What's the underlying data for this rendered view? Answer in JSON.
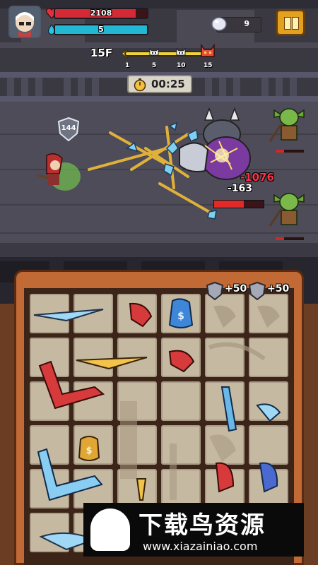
{
  "player": {
    "hp": "2108",
    "hp_ratio": 0.88,
    "mp": "5",
    "mp_ratio": 1.0
  },
  "currency": {
    "gems": "9"
  },
  "floor": {
    "label": "15F",
    "ticks": [
      "1",
      "5",
      "10",
      "15"
    ],
    "progress_ratio": 1.0
  },
  "timer": {
    "value": "00:25"
  },
  "battle": {
    "player_shield": "144",
    "damage_red": "-1076",
    "damage_white": "-163",
    "boss_hp_ratio": 0.6
  },
  "inventory": {
    "armor_badges": [
      "+50",
      "+50"
    ]
  },
  "watermark": {
    "title": "下载鸟资源",
    "url": "www.xiazainiao.com"
  },
  "colors": {
    "hp": "#d42a35",
    "mp": "#22b8d4",
    "accent_gold": "#e2a21f",
    "frame": "#c16a36"
  }
}
